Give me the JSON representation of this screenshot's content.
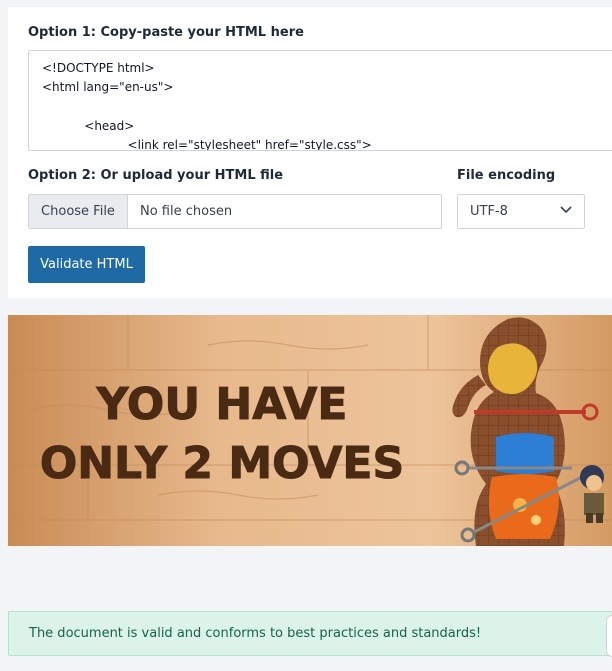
{
  "form": {
    "option1_label": "Option 1: Copy-paste your HTML here",
    "code_lines": [
      "<!DOCTYPE html>",
      "<html lang=\"en-us\">",
      "",
      "    <head>",
      "        <link rel=\"stylesheet\" href=\"style.css\">"
    ],
    "option2_label": "Option 2: Or upload your HTML file",
    "choose_file_label": "Choose File",
    "file_status": "No file chosen",
    "encoding_label": "File encoding",
    "encoding_value": "UTF-8",
    "validate_label": "Validate HTML"
  },
  "banner": {
    "line1": "YOU HAVE",
    "line2": "ONLY 2 MOVES"
  },
  "alert": {
    "message": "The document is valid and conforms to best practices and standards!"
  },
  "colors": {
    "primary_button": "#1f6aa5",
    "success_bg": "#dcf3ea",
    "success_text": "#16624a"
  }
}
